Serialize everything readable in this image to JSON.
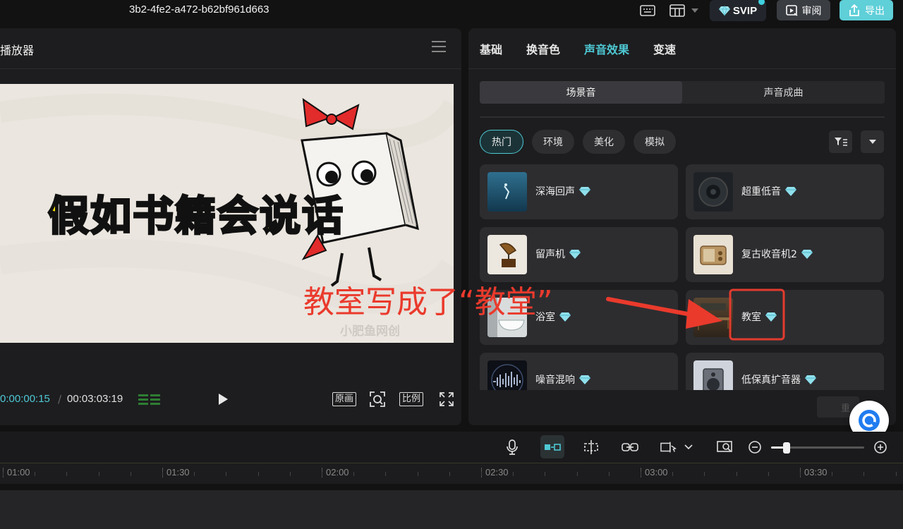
{
  "topbar": {
    "project_title": "3b2-4fe2-a472-b62bf961d663",
    "svip_label": "SVIP",
    "review_label": "审阅",
    "export_label": "导出"
  },
  "player": {
    "title": "播放器",
    "video_title": "假如书籍会说话",
    "watermark": "小肥鱼网创",
    "current_time": "0:00:00:15",
    "separator": "/",
    "total_time": "00:03:03:19",
    "original_label": "原画",
    "ratio_label": "比例"
  },
  "annotation": {
    "text": "教室写成了“教堂”",
    "color": "#ea3a2c"
  },
  "panel": {
    "tabs": [
      {
        "label": "基础",
        "active": false
      },
      {
        "label": "换音色",
        "active": false
      },
      {
        "label": "声音效果",
        "active": true
      },
      {
        "label": "变速",
        "active": false
      }
    ],
    "segments": [
      {
        "label": "场景音",
        "active": true
      },
      {
        "label": "声音成曲",
        "active": false
      }
    ],
    "chips": [
      {
        "label": "热门",
        "active": true
      },
      {
        "label": "环境",
        "active": false
      },
      {
        "label": "美化",
        "active": false
      },
      {
        "label": "模拟",
        "active": false
      }
    ],
    "cards": [
      {
        "label": "深海回声",
        "icon": "deep-sea-thumb"
      },
      {
        "label": "超重低音",
        "icon": "speaker-thumb"
      },
      {
        "label": "留声机",
        "icon": "gramophone-thumb"
      },
      {
        "label": "复古收音机2",
        "icon": "radio-thumb"
      },
      {
        "label": "浴室",
        "icon": "bathtub-thumb"
      },
      {
        "label": "教室",
        "icon": "classroom-thumb"
      },
      {
        "label": "噪音混响",
        "icon": "waveform-thumb"
      },
      {
        "label": "低保真扩音器",
        "icon": "amplifier-thumb"
      }
    ],
    "bottom_button": "重"
  },
  "timeline": {
    "ticks": [
      "01:00",
      "01:30",
      "02:00",
      "02:30",
      "03:00",
      "03:30"
    ],
    "zoom_level": 0.17
  },
  "colors": {
    "accent": "#4ec9d4",
    "background": "#121212",
    "panel": "#1d1d1f",
    "highlight_box": "#e23b2e"
  }
}
